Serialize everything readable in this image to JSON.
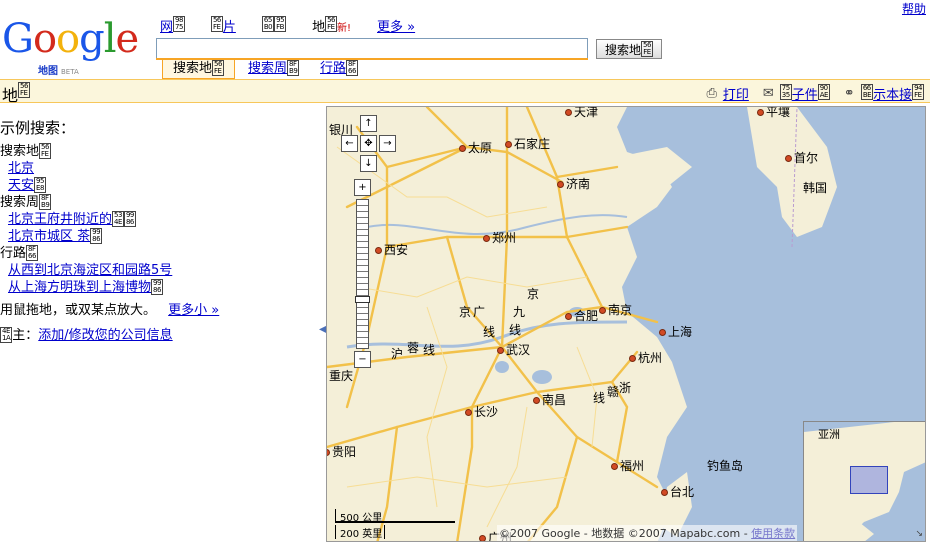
{
  "header": {
    "help": "帮助",
    "logo_text": "Google",
    "logo_sub": "地图",
    "logo_beta": "BETA",
    "tabs": [
      {
        "label": "网",
        "current": false
      },
      {
        "label": "片",
        "current": false
      },
      {
        "label": "",
        "current": false
      },
      {
        "label": "地",
        "badge": "新!",
        "current": true
      },
      {
        "label": "更多 »",
        "current": false
      }
    ],
    "search_placeholder": "",
    "search_button": "搜索地",
    "search_tabs": [
      "搜索地",
      "搜索周",
      "行路"
    ]
  },
  "title_bar": {
    "title": "地",
    "toolbar": [
      {
        "icon": "printer-icon",
        "glyph": "⎙",
        "label": "打印"
      },
      {
        "icon": "envelope-icon",
        "glyph": "✉",
        "label": "子件"
      },
      {
        "icon": "link-icon",
        "glyph": "⚭",
        "label": "示本接"
      }
    ]
  },
  "left_panel": {
    "examples_heading": "示例搜索：",
    "sections": [
      {
        "title": "搜索地",
        "links": [
          "北京",
          "天安"
        ]
      },
      {
        "title": "搜索周",
        "links": [
          "北京王府井附近的",
          "北京市城区 茶"
        ]
      },
      {
        "title": "行路",
        "links": [
          "从西到北京海淀区和园路5号",
          "从上海方明珠到上海博物"
        ]
      }
    ],
    "tip_text": "用鼠拖地，或双某点放大。",
    "tip_more": "更多小 »",
    "owner_prefix": "主：",
    "owner_link": "添加/修改您的公司信息"
  },
  "map": {
    "cities": [
      "天津",
      "太原",
      "石家庄",
      "济南",
      "郑州",
      "西安",
      "合肥",
      "南京",
      "上海",
      "武汉",
      "杭州",
      "南昌",
      "长沙",
      "福州",
      "台北",
      "贵阳",
      "重庆",
      "平壤",
      "首尔",
      "韩国",
      "钓鱼岛",
      "广州",
      "银川"
    ],
    "railway_labels": [
      "京",
      "广",
      "线",
      "京",
      "九",
      "线",
      "沪",
      "蓉",
      "线",
      "浙",
      "赣",
      "线"
    ],
    "scale": {
      "km": "500 公里",
      "mi": "200 英里"
    },
    "copyright": "©2007 Google - 地数据 ©2007 Mapabc.com - ",
    "terms": "使用条款",
    "overview_label": "亚洲",
    "colors": {
      "land": "#f4efd8",
      "water": "#a7bfdc",
      "road": "#f2c14a",
      "city_dot": "#d24a24"
    }
  }
}
